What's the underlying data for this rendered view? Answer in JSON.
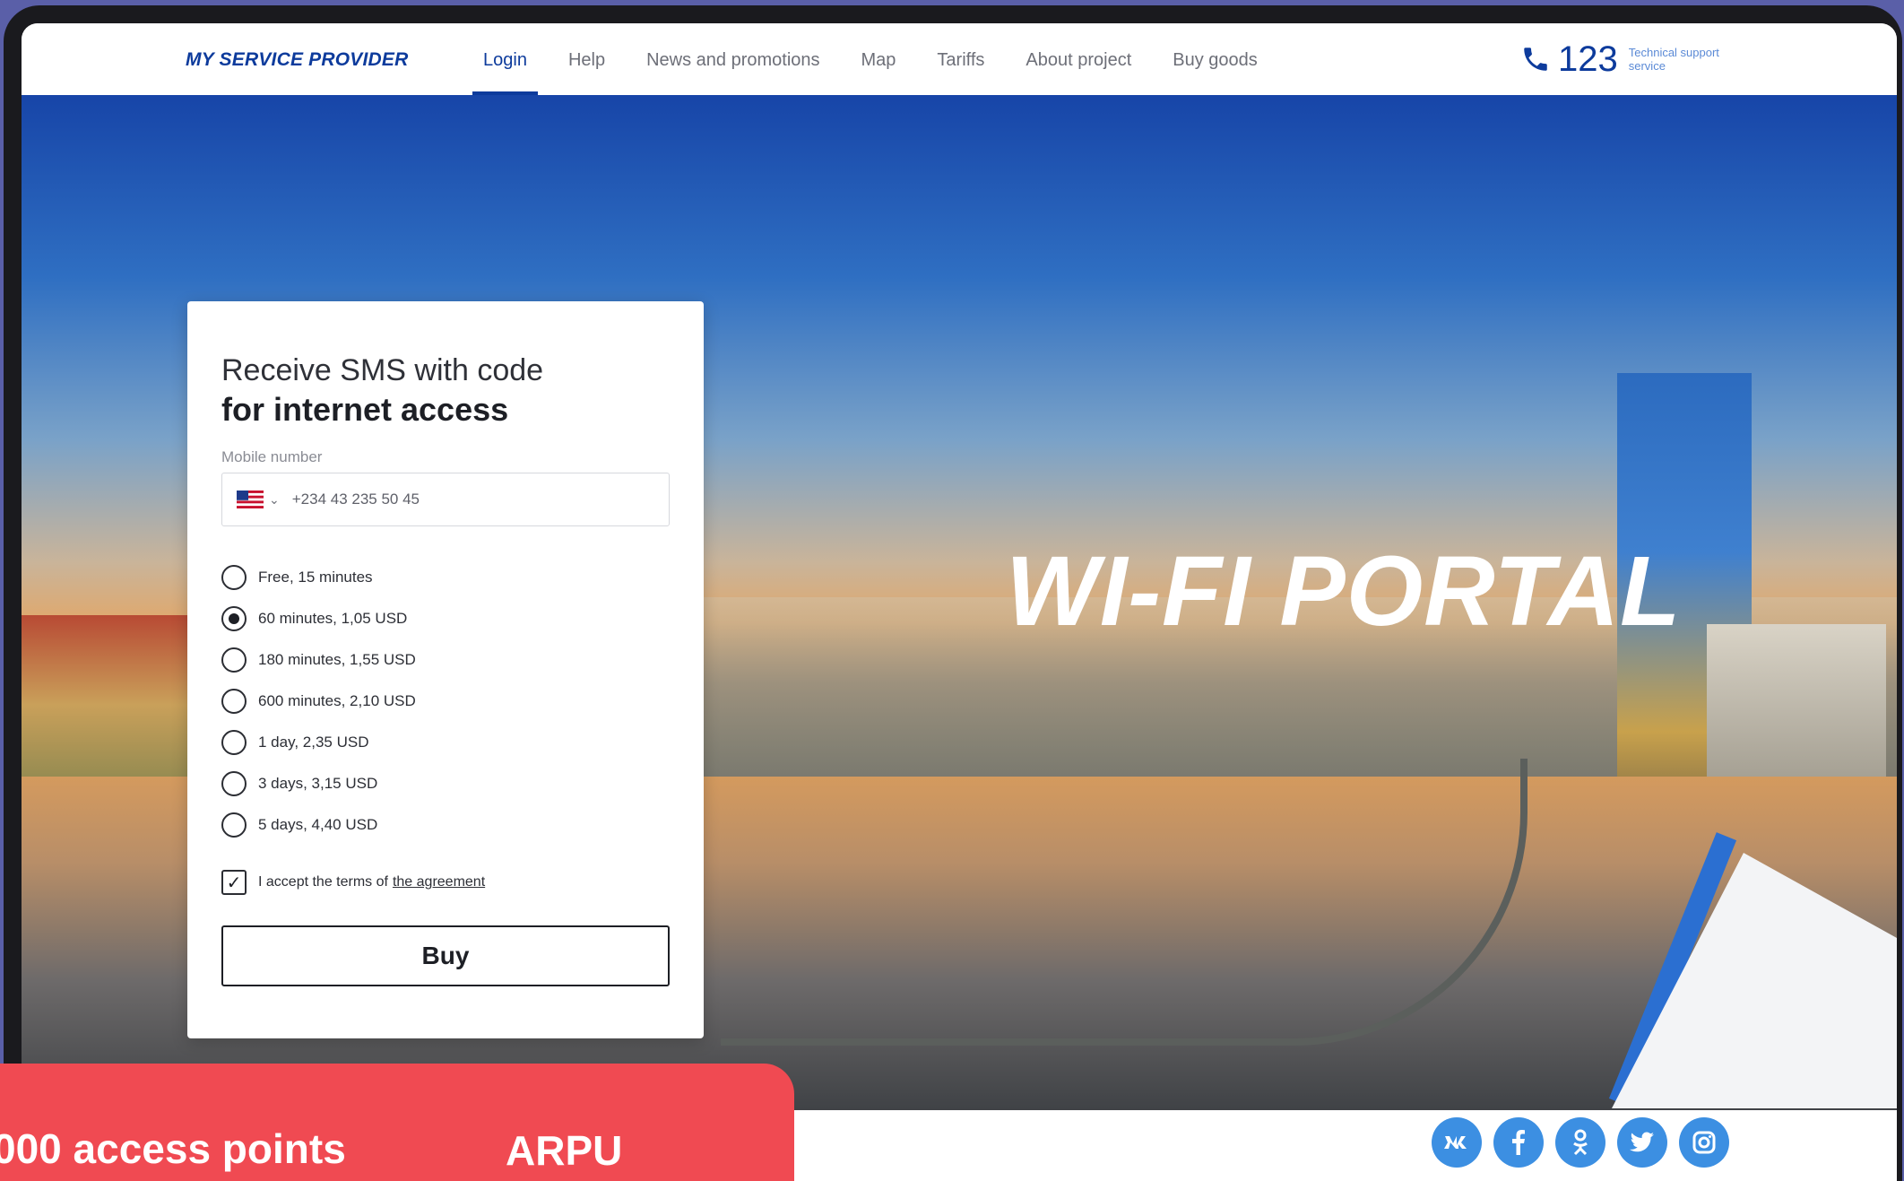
{
  "header": {
    "brand": "MY SERVICE PROVIDER",
    "nav": [
      "Login",
      "Help",
      "News and promotions",
      "Map",
      "Tariffs",
      "About project",
      "Buy goods"
    ],
    "active_nav": "Login",
    "support_number": "123",
    "support_label": "Technical support service"
  },
  "hero": {
    "title": "WI-FI PORTAL"
  },
  "login_card": {
    "title_line1": "Receive SMS with code",
    "title_line2": "for internet access",
    "phone_label": "Mobile number",
    "phone_value": "+234 43 235 50 45",
    "country_flag": "us-flag-icon",
    "options": [
      {
        "label": "Free, 15 minutes",
        "checked": false
      },
      {
        "label": "60 minutes, 1,05 USD",
        "checked": true
      },
      {
        "label": "180 minutes, 1,55 USD",
        "checked": false
      },
      {
        "label": "600 minutes, 2,10 USD",
        "checked": false
      },
      {
        "label": "1 day, 2,35 USD",
        "checked": false
      },
      {
        "label": "3 days, 3,15 USD",
        "checked": false
      },
      {
        "label": "5 days, 4,40 USD",
        "checked": false
      }
    ],
    "agree_text": "I accept the terms of",
    "agree_link": "the agreement",
    "agree_checked": true,
    "buy_label": "Buy"
  },
  "footer": {
    "socials": [
      "vk-icon",
      "facebook-icon",
      "odnoklassniki-icon",
      "twitter-icon",
      "instagram-icon"
    ]
  },
  "promo": {
    "text_left": "000 access points",
    "text_right": "ARPU"
  },
  "colors": {
    "brand_blue": "#0d3b9c",
    "social_blue": "#3c8fe2",
    "promo_red": "#f04a52"
  }
}
